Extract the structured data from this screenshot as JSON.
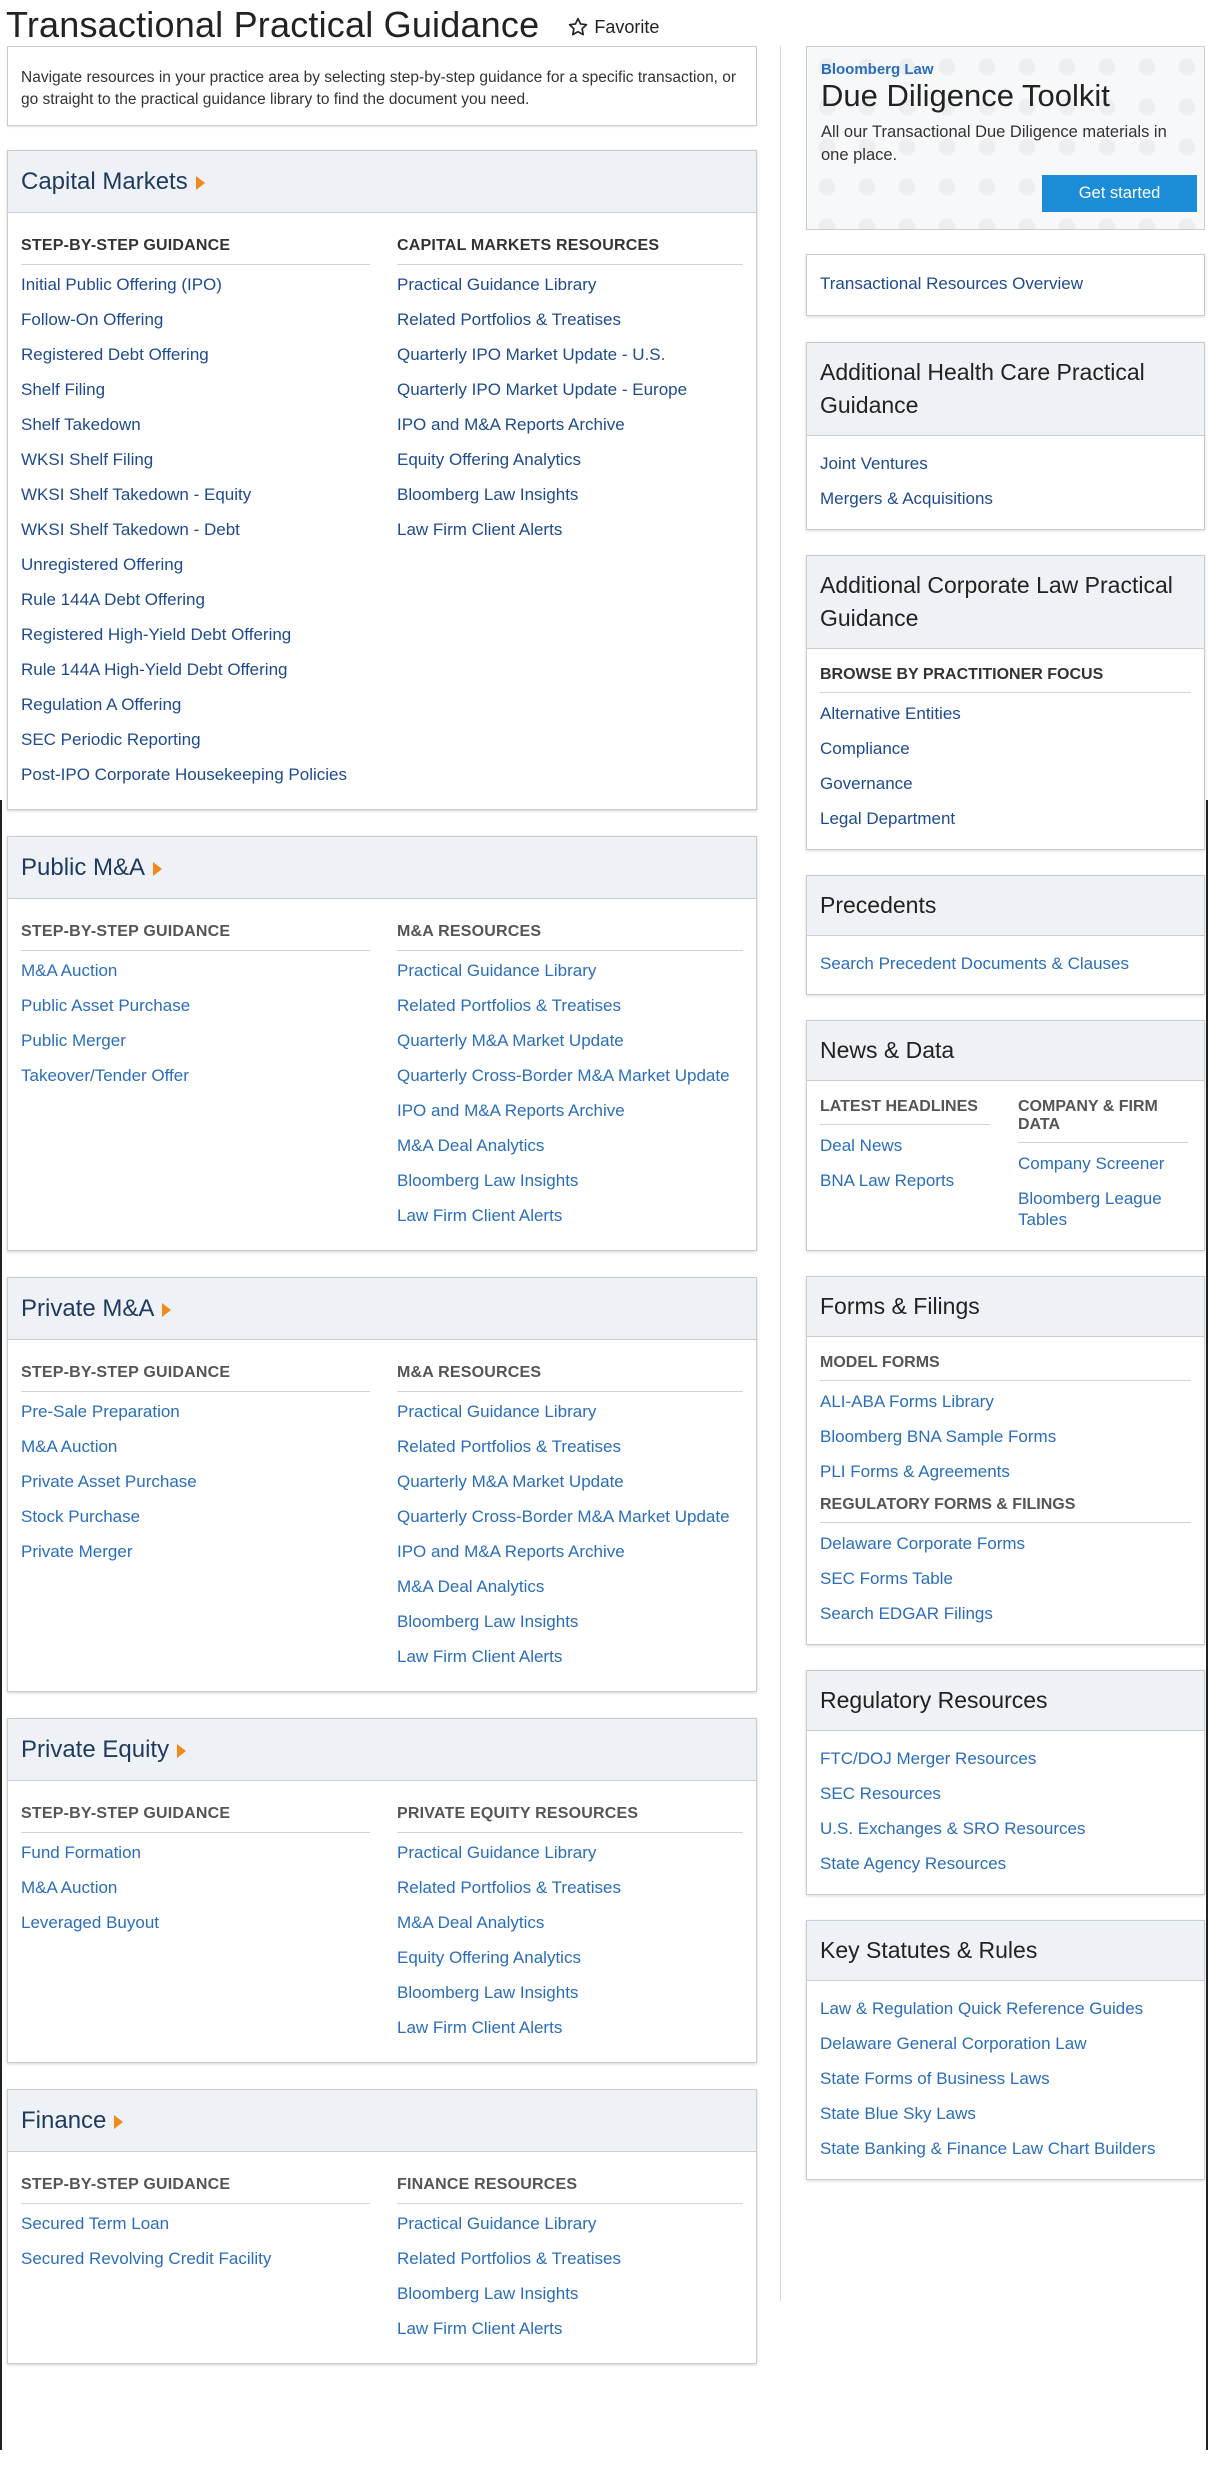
{
  "header": {
    "title": "Transactional Practical Guidance",
    "favorite_label": "Favorite"
  },
  "intro": {
    "text": "Navigate resources in your practice area by selecting step-by-step guidance for a specific transaction, or go straight to the practical guidance library to find the document you need."
  },
  "sections": [
    {
      "title": "Capital Markets",
      "left_heading": "STEP-BY-STEP GUIDANCE",
      "right_heading": "CAPITAL MARKETS RESOURCES",
      "left_links": [
        "Initial Public Offering (IPO)",
        "Follow-On Offering",
        "Registered Debt Offering",
        "Shelf Filing",
        "Shelf Takedown",
        "WKSI Shelf Filing",
        "WKSI Shelf Takedown - Equity",
        "WKSI Shelf Takedown - Debt",
        "Unregistered Offering",
        "Rule 144A Debt Offering",
        "Registered High-Yield Debt Offering",
        "Rule 144A High-Yield Debt Offering",
        "Regulation A Offering",
        "SEC Periodic Reporting",
        "Post-IPO Corporate Housekeeping Policies"
      ],
      "right_links": [
        "Practical Guidance Library",
        "Related Portfolios & Treatises",
        "Quarterly IPO Market Update - U.S.",
        "Quarterly IPO Market Update - Europe",
        "IPO and M&A Reports Archive",
        "Equity Offering Analytics",
        "Bloomberg Law Insights",
        "Law Firm Client Alerts"
      ]
    },
    {
      "title": "Public M&A",
      "left_heading": "STEP-BY-STEP GUIDANCE",
      "right_heading": "M&A RESOURCES",
      "left_links": [
        "M&A Auction",
        "Public Asset Purchase",
        "Public Merger",
        "Takeover/Tender Offer"
      ],
      "right_links": [
        "Practical Guidance Library",
        "Related Portfolios & Treatises",
        "Quarterly M&A Market Update",
        "Quarterly Cross-Border M&A Market Update",
        "IPO and M&A Reports Archive",
        "M&A Deal Analytics",
        "Bloomberg Law Insights",
        "Law Firm Client Alerts"
      ]
    },
    {
      "title": "Private M&A",
      "left_heading": "STEP-BY-STEP GUIDANCE",
      "right_heading": "M&A RESOURCES",
      "left_links": [
        "Pre-Sale Preparation",
        "M&A Auction",
        "Private Asset Purchase",
        "Stock Purchase",
        "Private Merger"
      ],
      "right_links": [
        "Practical Guidance Library",
        "Related Portfolios & Treatises",
        "Quarterly M&A Market Update",
        "Quarterly Cross-Border M&A Market Update",
        "IPO and M&A Reports Archive",
        "M&A Deal Analytics",
        "Bloomberg Law Insights",
        "Law Firm Client Alerts"
      ]
    },
    {
      "title": "Private Equity",
      "left_heading": "STEP-BY-STEP GUIDANCE",
      "right_heading": "PRIVATE EQUITY RESOURCES",
      "left_links": [
        "Fund Formation",
        "M&A Auction",
        "Leveraged Buyout"
      ],
      "right_links": [
        "Practical Guidance Library",
        "Related Portfolios & Treatises",
        "M&A Deal Analytics",
        "Equity Offering Analytics",
        "Bloomberg Law Insights",
        "Law Firm Client Alerts"
      ]
    },
    {
      "title": "Finance",
      "left_heading": "STEP-BY-STEP GUIDANCE",
      "right_heading": "FINANCE RESOURCES",
      "left_links": [
        "Secured Term Loan",
        "Secured Revolving Credit Facility"
      ],
      "right_links": [
        "Practical Guidance Library",
        "Related Portfolios & Treatises",
        "Bloomberg Law Insights",
        "Law Firm Client Alerts"
      ]
    }
  ],
  "promo": {
    "brand": "Bloomberg Law",
    "title": "Due Diligence Toolkit",
    "description": "All our Transactional Due Diligence materials in one place.",
    "button": "Get started"
  },
  "overview_link": "Transactional Resources Overview",
  "health_care": {
    "title": "Additional Health Care Practical Guidance",
    "links": [
      "Joint Ventures",
      "Mergers & Acquisitions"
    ]
  },
  "corporate_law": {
    "title": "Additional Corporate Law Practical Guidance",
    "subheading": "BROWSE BY PRACTITIONER FOCUS",
    "links": [
      "Alternative Entities",
      "Compliance",
      "Governance",
      "Legal Department"
    ]
  },
  "precedents": {
    "title": "Precedents",
    "links": [
      "Search Precedent Documents & Clauses"
    ]
  },
  "news_data": {
    "title": "News & Data",
    "left_heading": "LATEST HEADLINES",
    "right_heading": "COMPANY & FIRM DATA",
    "left_links": [
      "Deal News",
      "BNA Law Reports"
    ],
    "right_links": [
      "Company Screener",
      "Bloomberg League Tables"
    ]
  },
  "forms_filings": {
    "title": "Forms & Filings",
    "heading1": "MODEL FORMS",
    "links1": [
      "ALI-ABA Forms Library",
      "Bloomberg BNA Sample Forms",
      "PLI Forms & Agreements"
    ],
    "heading2": "REGULATORY FORMS & FILINGS",
    "links2": [
      "Delaware Corporate Forms",
      "SEC Forms Table",
      "Search EDGAR Filings"
    ]
  },
  "regulatory": {
    "title": "Regulatory Resources",
    "links": [
      "FTC/DOJ Merger Resources",
      "SEC Resources",
      "U.S. Exchanges & SRO Resources",
      "State Agency Resources"
    ]
  },
  "statutes": {
    "title": "Key Statutes & Rules",
    "links": [
      "Law & Regulation Quick Reference Guides",
      "Delaware General Corporation Law",
      "State Forms of Business Laws",
      "State Blue Sky Laws",
      "State Banking & Finance Law Chart Builders"
    ]
  },
  "colors": {
    "link": "#2a6ebb",
    "link_dark": "#1e4a8f",
    "accent_orange": "#f08a1c",
    "button_blue": "#1a8cd8",
    "panel_header": "#eef1f5"
  }
}
